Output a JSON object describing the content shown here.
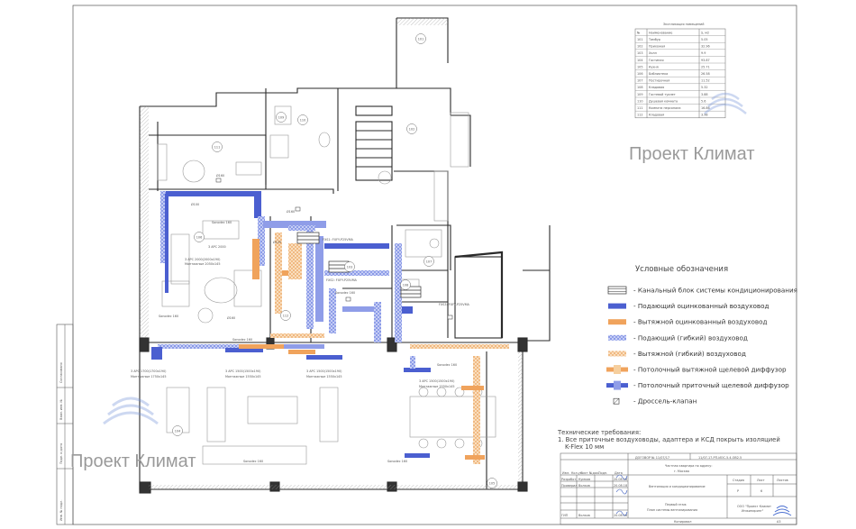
{
  "room_schedule": {
    "title": "Экспликация помещений",
    "headers": [
      "№",
      "Наименование",
      "S, м2"
    ],
    "rows": [
      [
        "101",
        "Тамбур",
        "5.05"
      ],
      [
        "102",
        "Прихожая",
        "32.96"
      ],
      [
        "103",
        "Холл",
        "9.9"
      ],
      [
        "104",
        "Гостиная",
        "93.87"
      ],
      [
        "105",
        "Кухня",
        "25.71"
      ],
      [
        "106",
        "Библиотека",
        "26.58"
      ],
      [
        "107",
        "Постирочная",
        "11.52"
      ],
      [
        "108",
        "Кладовая",
        "5.32"
      ],
      [
        "109",
        "Гостевой туалет",
        "3.88"
      ],
      [
        "110",
        "Душевая комната",
        "5.6"
      ],
      [
        "111",
        "Комната персонала",
        "16.86"
      ],
      [
        "112",
        "Кладовая",
        "3.98"
      ]
    ]
  },
  "watermarks": {
    "main": "Проект Климат",
    "bottom": "Проект Климат"
  },
  "legend": {
    "title": "Условные обозначения",
    "items": [
      {
        "symbol": "ac-duct-unit",
        "label": "- Канальный блок системы кондиционирования"
      },
      {
        "symbol": "supply-galv",
        "label": "- Подающий оцинкованный воздуховод"
      },
      {
        "symbol": "exhaust-galv",
        "label": "- Вытяжной оцинкованный воздуховод"
      },
      {
        "symbol": "supply-flex",
        "label": "- Подающий (гибкий) воздуховод"
      },
      {
        "symbol": "exhaust-flex",
        "label": "- Вытяжной (гибкий) воздуховод"
      },
      {
        "symbol": "exhaust-diffuser",
        "label": "- Потолочный вытяжной щелевой диффузор"
      },
      {
        "symbol": "supply-diffuser",
        "label": "- Потолочный приточный щелевой диффузор"
      },
      {
        "symbol": "damper",
        "label": "- Дроссель-клапан"
      }
    ]
  },
  "tech_requirements": {
    "title": "Технические требования:",
    "line1": "1. Все приточные воздуховоды, адаптера и КСД покрыть изоляцией",
    "line2": "K-Flex 10 мм"
  },
  "title_block": {
    "contract": "ДОГОВОР № 11/07/17",
    "code": "11/07-17-РП-ИОС-5.4-ОВ2.5",
    "object_line1": "Частная квартира по адресу:",
    "object_line2": "г. Москва",
    "section": "Вентиляция и кондиционирование",
    "stage_header": "Стадия",
    "sheet_header": "Лист",
    "sheets_header": "Листов",
    "stage_value": "Р",
    "sheet_value": "6",
    "sheet_name_line1": "Первый этаж",
    "sheet_name_line2": "План системы вентилирования",
    "company_line1": "ООО \"Проект Климат",
    "company_line2": "Инжиниринг\"",
    "roles": [
      {
        "role": "Разработ.",
        "name": "Кумков",
        "date": "20.08.18"
      },
      {
        "role": "Проверил",
        "name": "Волков",
        "date": "20.08.18"
      },
      {
        "role": "",
        "name": "",
        "date": ""
      },
      {
        "role": "ГИП",
        "name": "Волков",
        "date": "20.08.18"
      }
    ],
    "col_headers": [
      "Изм.",
      "Кол.уч.",
      "Лист",
      "№док.",
      "Подп.",
      "Дата"
    ],
    "copied": "Копировал",
    "format": "А3"
  },
  "left_stamp": {
    "labels": [
      "Согласовано",
      "Инв. № подл.",
      "Подп. и дата",
      "Взам. инв. №"
    ]
  },
  "room_numbers": [
    "101",
    "102",
    "103",
    "104",
    "105",
    "106",
    "107",
    "108",
    "109",
    "110",
    "111",
    "112"
  ],
  "plan_labels": {
    "ac1": "3 APC 2000",
    "ac1_note": "3 APC 2000(2000x190)",
    "ac1_mount": "Монтажные 2050x145",
    "ac2": "3 APC 1500(1500x190)",
    "ac2_mount": "Монтажные 1550x145",
    "ac3": "3 APC 1500(1500x190)",
    "ac3_mount": "Монтажные 1550x145",
    "ac4": "3 APC 1500(1500x190)",
    "ac4_mount": "Монтажные 1550x145",
    "ac5": "3 APC 1700(1700x190)",
    "ac5_mount": "Монтажные 1750x145",
    "unit1": "FXS1: FXFY-P25VMA",
    "unit2": "FXS2: FXFY-P25VMA",
    "unit3": "FXS3: FXFY-P25VMA",
    "sonodec": "Sonodec 160",
    "d160": "Ø160",
    "d100": "Ø100",
    "d125": "Ø125"
  },
  "colors": {
    "supply": "#4b5fd0",
    "supply_flex": "#8f9de8",
    "exhaust": "#f0a35c",
    "exhaust_flex": "#f6cf9e",
    "wall": "#2a2a2a",
    "grid": "#bfbfbf"
  }
}
